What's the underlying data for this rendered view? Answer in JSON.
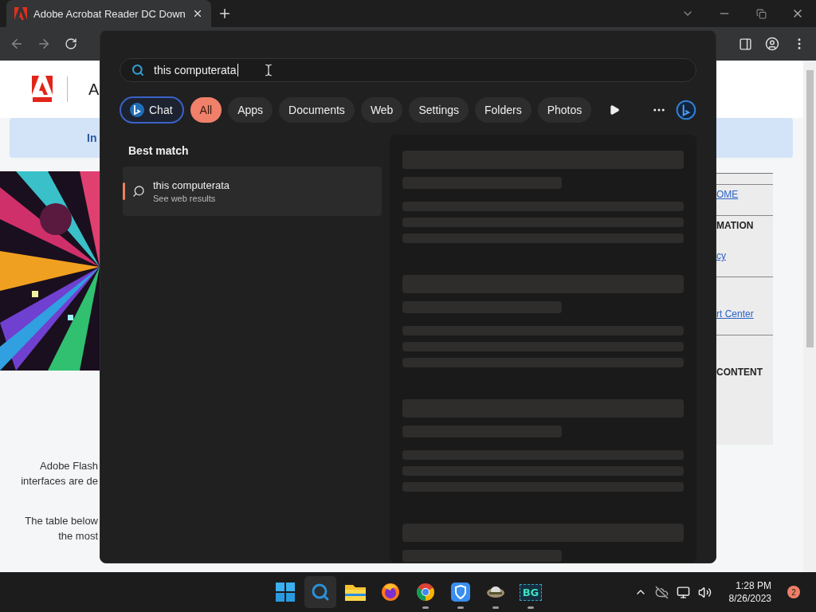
{
  "browser": {
    "tab": {
      "title": "Adobe Acrobat Reader DC Down",
      "selected": true
    }
  },
  "page": {
    "heading_fragment": "A",
    "banner_fragment": "In",
    "left_texts": [
      {
        "lines": [
          "Adobe Flash",
          "interfaces are de"
        ]
      },
      {
        "lines": [
          "The table below",
          "the most"
        ]
      }
    ],
    "sidebar": [
      {
        "kind": "link",
        "text": "OME",
        "ruled": true
      },
      {
        "kind": "heading",
        "text": "MATION",
        "ruled": true
      },
      {
        "kind": "link",
        "text": "cy",
        "ruled": false
      },
      {
        "kind": "link",
        "text": "rt Center",
        "ruled": true
      },
      {
        "kind": "heading",
        "text": "CONTENT",
        "ruled": true
      }
    ]
  },
  "search": {
    "query": "this computerata",
    "chat": "Chat",
    "filters": [
      {
        "label": "All",
        "selected": true
      },
      {
        "label": "Apps",
        "selected": false
      },
      {
        "label": "Documents",
        "selected": false
      },
      {
        "label": "Web",
        "selected": false
      },
      {
        "label": "Settings",
        "selected": false
      },
      {
        "label": "Folders",
        "selected": false
      },
      {
        "label": "Photos",
        "selected": false
      }
    ],
    "best_match": {
      "heading": "Best match",
      "title": "this computerata",
      "subtitle": "See web results",
      "selected": true
    }
  },
  "taskbar": {
    "apps": [
      {
        "kind": "start",
        "running": false,
        "selected": false
      },
      {
        "kind": "search",
        "running": false,
        "selected": true
      },
      {
        "kind": "folder",
        "running": false,
        "selected": false
      },
      {
        "kind": "firefox",
        "running": false,
        "selected": false
      },
      {
        "kind": "chrome",
        "running": true,
        "selected": false
      },
      {
        "kind": "shield",
        "running": true,
        "selected": false
      },
      {
        "kind": "app",
        "running": true,
        "selected": false
      },
      {
        "kind": "text",
        "label": "BG",
        "running": true,
        "selected": false
      }
    ],
    "time": "1:28 PM",
    "date": "8/26/2023",
    "notifications": "2"
  }
}
